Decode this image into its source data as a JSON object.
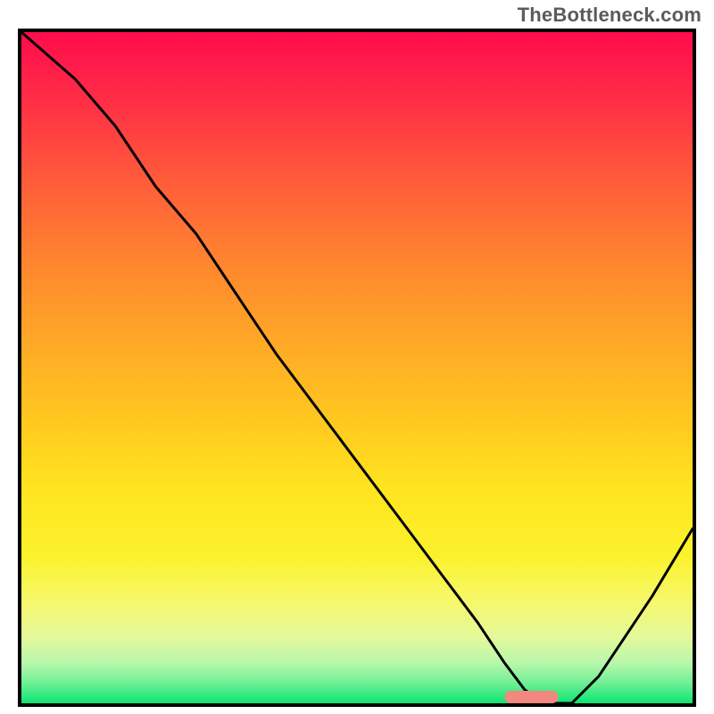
{
  "watermark": "TheBottleneck.com",
  "chart_data": {
    "type": "line",
    "title": "",
    "xlabel": "",
    "ylabel": "",
    "xlim": [
      0,
      100
    ],
    "ylim": [
      0,
      100
    ],
    "grid": false,
    "legend": false,
    "background_gradient_stops": [
      {
        "pos": 0,
        "color": "#ff0b4c"
      },
      {
        "pos": 10,
        "color": "#ff2d46"
      },
      {
        "pos": 22,
        "color": "#ff5b3a"
      },
      {
        "pos": 34,
        "color": "#ff842f"
      },
      {
        "pos": 46,
        "color": "#ffa826"
      },
      {
        "pos": 58,
        "color": "#ffc81f"
      },
      {
        "pos": 68,
        "color": "#ffe41f"
      },
      {
        "pos": 78,
        "color": "#fbf22c"
      },
      {
        "pos": 85,
        "color": "#f6f86c"
      },
      {
        "pos": 90,
        "color": "#e5f99a"
      },
      {
        "pos": 94,
        "color": "#b8f7ab"
      },
      {
        "pos": 97,
        "color": "#6fef95"
      },
      {
        "pos": 99,
        "color": "#2de97d"
      },
      {
        "pos": 100,
        "color": "#0be373"
      }
    ],
    "series": [
      {
        "name": "bottleneck-curve",
        "color": "#000000",
        "x": [
          0,
          8,
          14,
          20,
          26,
          32,
          38,
          44,
          50,
          56,
          62,
          68,
          72,
          75,
          78,
          82,
          86,
          90,
          94,
          100
        ],
        "y": [
          100,
          93,
          86,
          77,
          70,
          61,
          52,
          44,
          36,
          28,
          20,
          12,
          6,
          2,
          0,
          0,
          4,
          10,
          16,
          26
        ]
      }
    ],
    "marker": {
      "name": "optimal-range",
      "color": "#f2887f",
      "x_start": 72,
      "x_end": 80,
      "y": 0
    }
  }
}
